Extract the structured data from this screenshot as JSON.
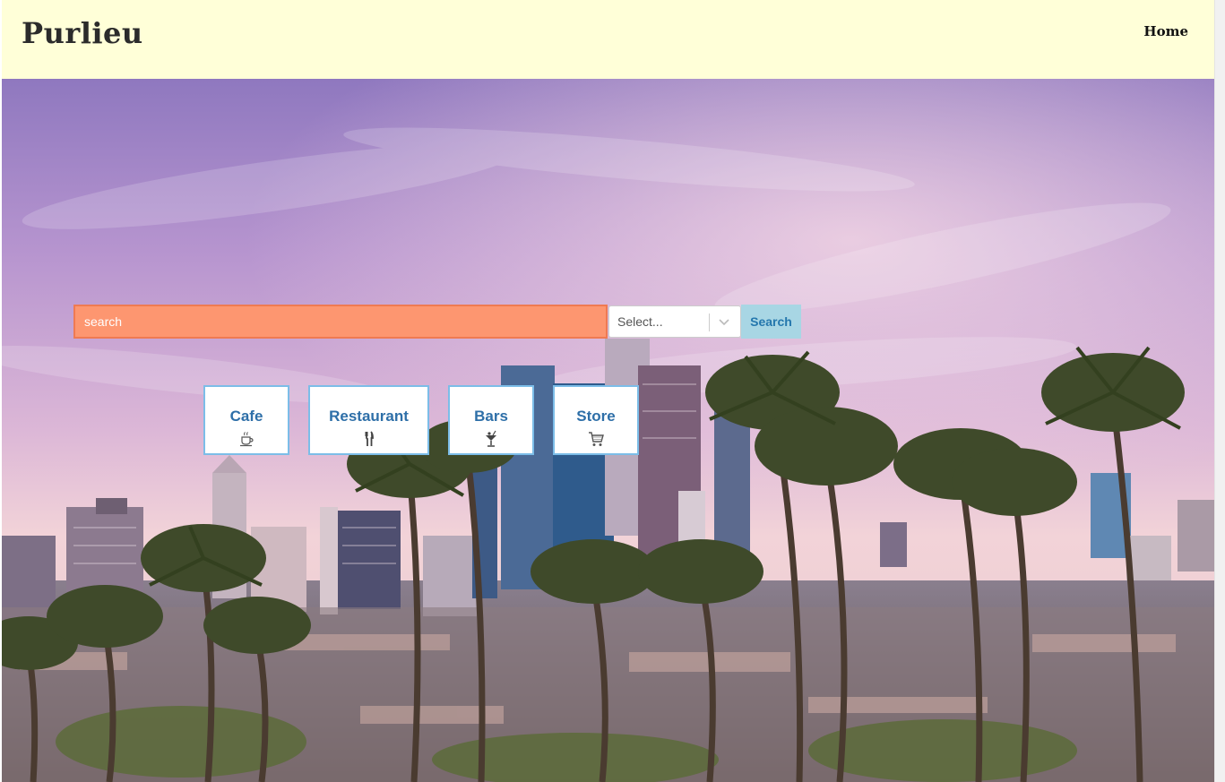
{
  "header": {
    "brand": "Purlieu",
    "nav": {
      "home_label": "Home"
    },
    "background_color": "#ffffd8"
  },
  "search": {
    "placeholder": "search",
    "value": "",
    "select_value": "Select...",
    "button_label": "Search",
    "input_color": "#fd9670",
    "button_color": "#a8d6e4"
  },
  "categories": [
    {
      "label": "Cafe",
      "icon": "coffee-cup-icon"
    },
    {
      "label": "Restaurant",
      "icon": "fork-knife-icon"
    },
    {
      "label": "Bars",
      "icon": "cocktail-icon"
    },
    {
      "label": "Store",
      "icon": "shopping-cart-icon"
    }
  ],
  "hero": {
    "image": "los-angeles-skyline-with-palm-trees"
  }
}
